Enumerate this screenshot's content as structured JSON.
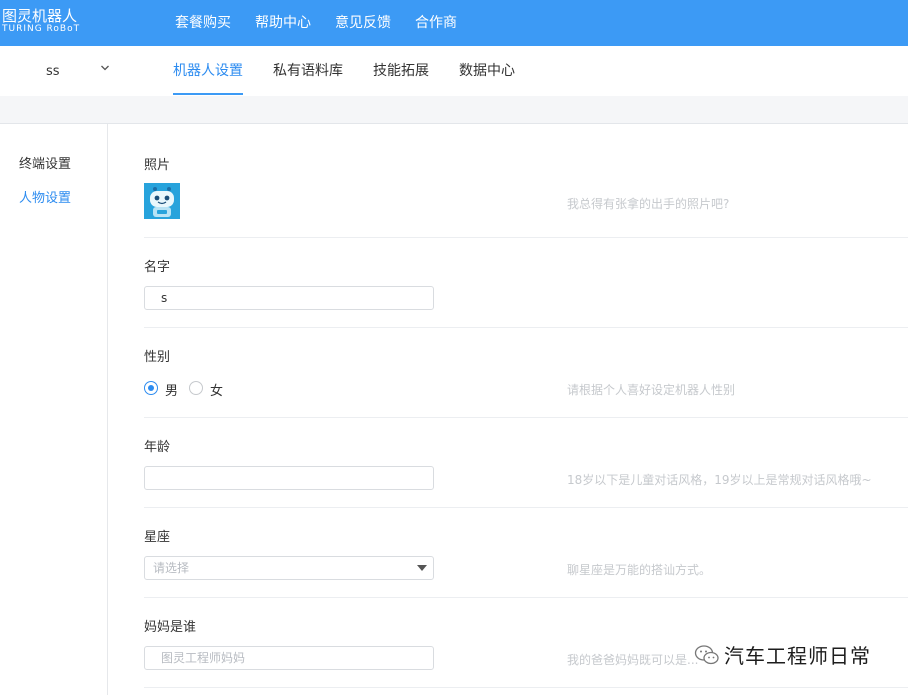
{
  "brand": {
    "logo_cn": "图灵机器人",
    "logo_en": "TURING RoBoT"
  },
  "top_nav": [
    "套餐购买",
    "帮助中心",
    "意见反馈",
    "合作商"
  ],
  "robot_selector": {
    "value": "ss"
  },
  "sub_nav": [
    {
      "label": "机器人设置",
      "active": true
    },
    {
      "label": "私有语料库",
      "active": false
    },
    {
      "label": "技能拓展",
      "active": false
    },
    {
      "label": "数据中心",
      "active": false
    }
  ],
  "side_menu": [
    {
      "label": "终端设置",
      "active": false
    },
    {
      "label": "人物设置",
      "active": true
    }
  ],
  "form": {
    "photo": {
      "label": "照片",
      "hint": "我总得有张拿的出手的照片吧?"
    },
    "name": {
      "label": "名字",
      "value": "s"
    },
    "gender": {
      "label": "性别",
      "options": [
        "男",
        "女"
      ],
      "selected": "男",
      "hint": "请根据个人喜好设定机器人性别"
    },
    "age": {
      "label": "年龄",
      "value": "",
      "hint": "18岁以下是儿童对话风格，19岁以上是常规对话风格哦~"
    },
    "constellation": {
      "label": "星座",
      "placeholder": "请选择",
      "hint": "聊星座是万能的搭讪方式。"
    },
    "mother": {
      "label": "妈妈是谁",
      "placeholder": "图灵工程师妈妈",
      "hint": "我的爸爸妈妈既可以是..."
    }
  },
  "watermark": {
    "text": "汽车工程师日常"
  },
  "colors": {
    "primary": "#3c9af5",
    "active_text": "#2d8cf0",
    "avatar_bg": "#27a3dc"
  }
}
